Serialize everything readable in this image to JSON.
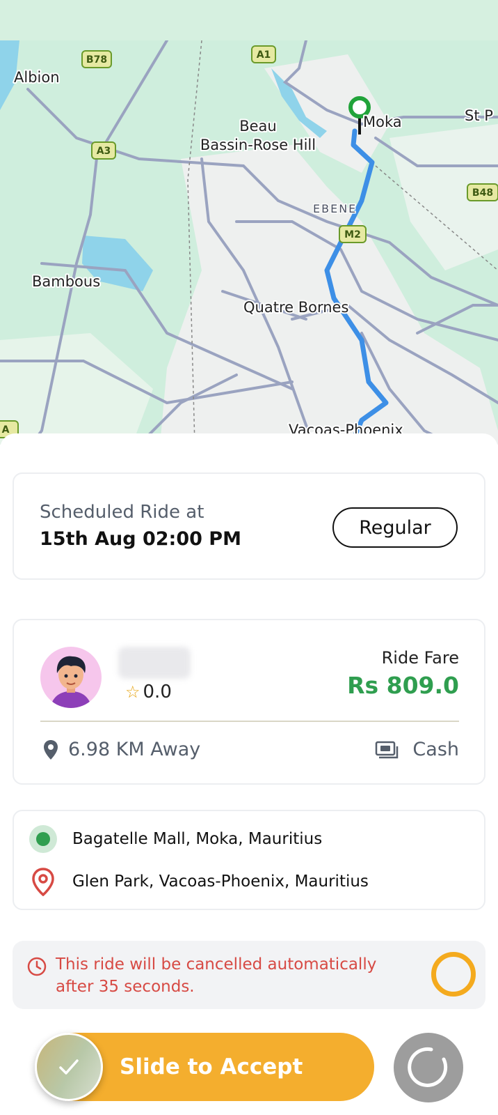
{
  "map": {
    "labels": {
      "albion": "Albion",
      "beau": "Beau",
      "bassin": "Bassin-Rose Hill",
      "moka": "Moka",
      "stp": "St P",
      "ebene": "EBENE",
      "bambous": "Bambous",
      "quatre_bornes": "Quatre Bornes",
      "vacoas": "Vacoas-Phoenix"
    },
    "shields": {
      "b78": "B78",
      "a1": "A1",
      "a3": "A3",
      "b48": "B48",
      "m2": "M2",
      "a0": "A"
    }
  },
  "schedule": {
    "label": "Scheduled Ride at",
    "time": "15th Aug 02:00 PM",
    "type_button": "Regular"
  },
  "rider": {
    "rating": "0.0",
    "fare_label": "Ride Fare",
    "fare_value": "Rs 809.0",
    "distance": "6.98 KM Away",
    "payment": "Cash"
  },
  "route": {
    "pickup": "Bagatelle Mall, Moka, Mauritius",
    "dropoff": "Glen Park, Vacoas-Phoenix, Mauritius"
  },
  "notice": {
    "text": "This ride will be cancelled automatically after 35 seconds."
  },
  "actions": {
    "slide_label": "Slide to Accept"
  },
  "colors": {
    "accent": "#f4ae2e",
    "fare_green": "#2f9e4f",
    "warning_red": "#d74a44",
    "route_blue": "#3d8fe6"
  },
  "icons": {
    "rating": "star-icon",
    "distance": "location-pin-icon",
    "payment": "cash-icon",
    "pickup": "pickup-dot-icon",
    "dropoff": "dropoff-pin-icon",
    "notice": "clock-icon",
    "slider": "check-icon",
    "refresh": "refresh-icon"
  }
}
